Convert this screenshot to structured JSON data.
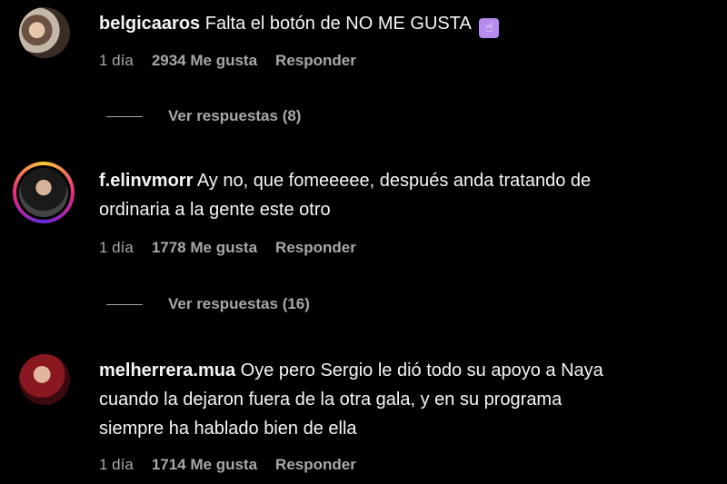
{
  "comments": [
    {
      "username": "belgicaaros",
      "text": "Falta el botón de NO ME GUSTA",
      "emoji": "hand-up-emoji",
      "age": "1 día",
      "likes": "2934 Me gusta",
      "reply": "Responder",
      "view_replies": "Ver respuestas (8)"
    },
    {
      "username": "f.elinvmorr",
      "text_line1": "Ay no, que fomeeeee, después anda tratando de",
      "text_line2": "ordinaria a la gente este otro",
      "age": "1 día",
      "likes": "1778 Me gusta",
      "reply": "Responder",
      "view_replies": "Ver respuestas (16)"
    },
    {
      "username": "melherrera.mua",
      "text_line1": "Oye pero Sergio le dió todo su apoyo a Naya",
      "text_line2": "cuando la dejaron fuera de la otra gala, y en su programa",
      "text_line3": "siempre ha hablado bien de ella",
      "age": "1 día",
      "likes": "1714 Me gusta",
      "reply": "Responder"
    }
  ],
  "colors": {
    "background": "#000000",
    "text": "#f5f5f5",
    "secondary": "#a8a8a8",
    "story_ring": [
      "#f9ce34",
      "#ee2a7b",
      "#6228d7"
    ]
  }
}
